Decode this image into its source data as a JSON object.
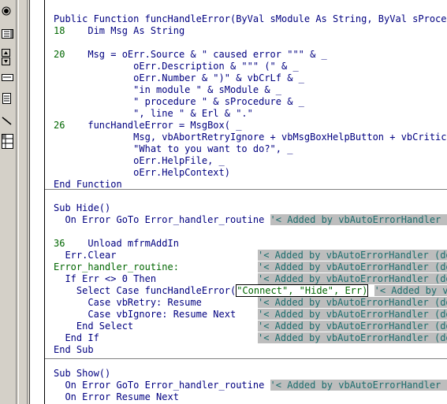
{
  "toolbox": {
    "items": [
      "pointer-icon",
      "list-box-icon",
      "spin-arrows-icon",
      "textbox-icon",
      "document-icon",
      "line-icon",
      "grid-icon"
    ]
  },
  "code": {
    "section1": [
      [
        "Public Function funcHandleError(ByVal sModule As String, ByVal sProcedure"
      ],
      [
        "18",
        "    Dim Msg As String"
      ],
      [
        ""
      ],
      [
        "20",
        "    Msg = oErr.Source & \" caused error \"\"\" & _"
      ],
      [
        "",
        "            oErr.Description & \"\"\" (\" & _"
      ],
      [
        "",
        "            oErr.Number & \")\" & vbCrLf & _"
      ],
      [
        "",
        "            \"in module \" & sModule & _"
      ],
      [
        "",
        "            \" procedure \" & sProcedure & _"
      ],
      [
        "",
        "            \", line \" & Erl & \".\""
      ],
      [
        "26",
        "    funcHandleError = MsgBox( _"
      ],
      [
        "",
        "            Msg, vbAbortRetryIgnore + vbMsgBoxHelpButton + vbCritical, _"
      ],
      [
        "",
        "            \"What to you want to do?\", _"
      ],
      [
        "",
        "            oErr.HelpFile, _"
      ],
      [
        "",
        "            oErr.HelpContext)"
      ],
      [
        "End Function"
      ]
    ],
    "section2": {
      "sub_hide": "Sub Hide()",
      "on_error": "  On Error GoTo Error_handler_routine ",
      "on_error_cmt": "'< Added by vbAutoErrorHandler (do",
      "unload_ln": "36",
      "unload": "    Unload mfrmAddIn",
      "err_clear": "  Err.Clear",
      "err_clear_cmt": "'< Added by vbAutoErrorHandler (do",
      "label": "Error_handler_routine:",
      "label_cmt": "'< Added by vbAutoErrorHandler (do",
      "if_err": "  If Err <> 0 Then",
      "if_err_cmt": "'< Added by vbAutoErrorHandler (do",
      "select_pre": "    Select Case funcHandleError(",
      "select_args": "\"Connect\", \"Hide\", Err)",
      "select_cmt": "'< Added by vbAu",
      "case_retry": "      Case vbRetry: Resume",
      "case_retry_cmt": "'< Added by vbAutoErrorHandler (do",
      "case_ignore": "      Case vbIgnore: Resume Next",
      "case_ignore_cmt": "'< Added by vbAutoErrorHandler (do",
      "end_select": "    End Select",
      "end_select_cmt": "'< Added by vbAutoErrorHandler (do",
      "end_if": "  End If",
      "end_if_cmt": "'< Added by vbAutoErrorHandler (do",
      "end_sub": "End Sub"
    },
    "section3": {
      "sub_show": "Sub Show()",
      "on_error": "  On Error GoTo Error_handler_routine ",
      "on_error_cmt": "'< Added by vbAutoErrorHandler (do",
      "resume_next": "  On Error Resume Next"
    }
  }
}
